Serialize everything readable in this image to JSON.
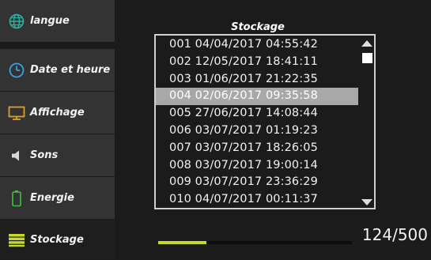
{
  "sidebar": {
    "items": [
      {
        "label": "langue",
        "icon": "globe-icon",
        "active": false
      },
      {
        "label": "Date et heure",
        "icon": "clock-icon",
        "active": false
      },
      {
        "label": "Affichage",
        "icon": "monitor-icon",
        "active": false
      },
      {
        "label": "Sons",
        "icon": "speaker-icon",
        "active": false
      },
      {
        "label": "Energie",
        "icon": "battery-icon",
        "active": false
      },
      {
        "label": "Stockage",
        "icon": "storage-icon",
        "active": true
      }
    ]
  },
  "main": {
    "title": "Stockage",
    "entries": [
      "001 04/04/2017 04:55:42",
      "002 12/05/2017 18:41:11",
      "003 01/06/2017 21:22:35",
      "004 02/06/2017 09:35:58",
      "005 27/06/2017 14:08:44",
      "006 03/07/2017 01:19:23",
      "007 03/07/2017 18:26:05",
      "008 03/07/2017 19:00:14",
      "009 03/07/2017 23:36:29",
      "010 04/07/2017 00:11:37"
    ],
    "selected_index": 3,
    "counter": "124/500",
    "storage_fraction": 0.248
  },
  "colors": {
    "accent": "#c8d828",
    "globe": "#2bb3a3",
    "clock": "#3aa0e0",
    "monitor": "#e0a020",
    "battery": "#40c040",
    "selection": "#a8a8a8"
  }
}
